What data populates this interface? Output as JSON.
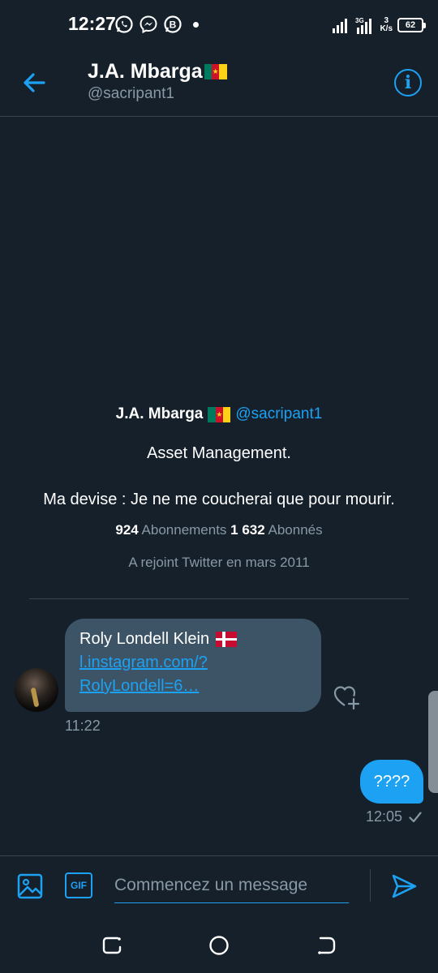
{
  "status_bar": {
    "time": "12:27",
    "network_speed_top": "3",
    "network_speed_bottom": "K/s",
    "battery": "62"
  },
  "header": {
    "name": "J.A. Mbarga",
    "handle": "@sacripant1"
  },
  "profile": {
    "name": "J.A. Mbarga",
    "handle": "@sacripant1",
    "bio_line1": "Asset Management.",
    "bio_line2": "Ma devise : Je ne me coucherai que pour mourir.",
    "following_count": "924",
    "following_label": "Abonnements",
    "followers_count": "1 632",
    "followers_label": "Abonnés",
    "joined": "A rejoint Twitter en mars 2011"
  },
  "messages": [
    {
      "direction": "incoming",
      "sender": "Roly Londell Klein",
      "link_line1": "l.instagram.com/?",
      "link_line2": "RolyLondell=6…",
      "time": "11:22"
    },
    {
      "direction": "outgoing",
      "text": "????",
      "time": "12:05",
      "status_icon": "check-icon"
    }
  ],
  "composer": {
    "placeholder": "Commencez un message",
    "gif_label": "GIF"
  },
  "colors": {
    "background": "#15202b",
    "accent": "#1da1f2",
    "incoming_bubble": "#3d5466",
    "secondary_text": "#8899a6",
    "divider": "#38444d"
  }
}
